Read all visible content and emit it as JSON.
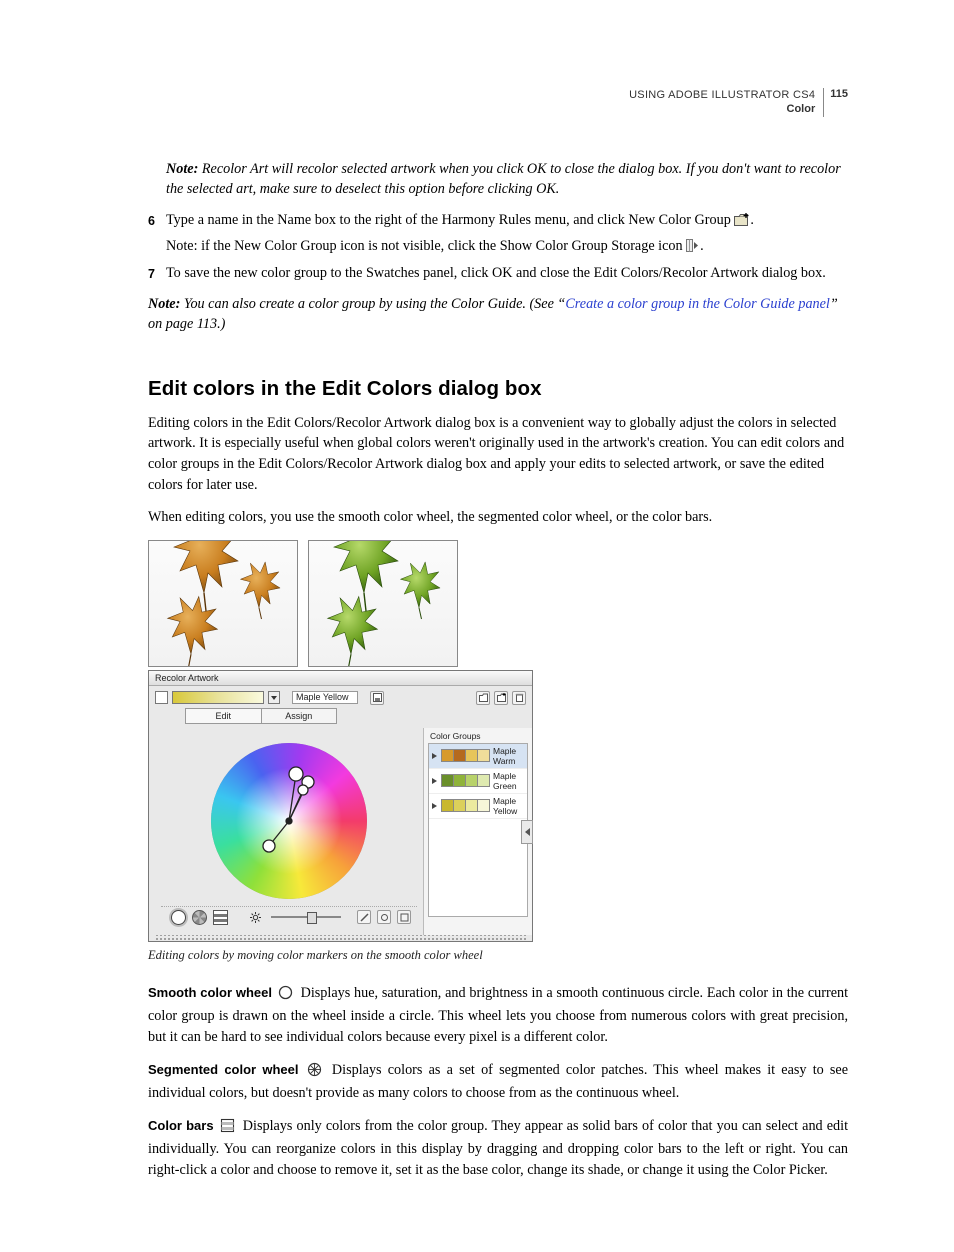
{
  "header": {
    "product": "USING ADOBE ILLUSTRATOR CS4",
    "section": "Color",
    "page": "115"
  },
  "notes": {
    "n1_label": "Note:",
    "n1_text": " Recolor Art will recolor selected artwork when you click OK to close the dialog box. If you don't want to recolor the selected art, make sure to deselect this option before clicking OK.",
    "n2_label": "Note:",
    "n2_text": " if the New Color Group icon is not visible, click the Show Color Group Storage icon ",
    "n3_label": "Note:",
    "n3_pre": " You can also create a color group by using the Color Guide. (See “",
    "n3_link": "Create a color group in the Color Guide panel",
    "n3_post": "” on page 113.)"
  },
  "steps": {
    "s6_num": "6",
    "s6_text": "Type a name in the Name box to the right of the Harmony Rules menu, and click New Color Group ",
    "s6_tail": ".",
    "s7_num": "7",
    "s7_text": "To save the new color group to the Swatches panel, click OK and close the Edit Colors/Recolor Artwork dialog box."
  },
  "section_heading": "Edit colors in the Edit Colors dialog box",
  "para1": "Editing colors in the Edit Colors/Recolor Artwork dialog box is a convenient way to globally adjust the colors in selected artwork. It is especially useful when global colors weren't originally used in the artwork's creation. You can edit colors and color groups in the Edit Colors/Recolor Artwork dialog box and apply your edits to selected artwork, or save the edited colors for later use.",
  "para2": "When editing colors, you use the smooth color wheel, the segmented color wheel, or the color bars.",
  "dialog": {
    "title": "Recolor Artwork",
    "name_field": "Maple Yellow",
    "tab_edit": "Edit",
    "tab_assign": "Assign",
    "cg_title": "Color Groups",
    "groups": [
      {
        "label": "Maple Warm",
        "c": [
          "#d79a2b",
          "#b56a1e",
          "#e7c55a",
          "#f0dd9a"
        ]
      },
      {
        "label": "Maple Green",
        "c": [
          "#6a8f2a",
          "#8fb33a",
          "#b8d26a",
          "#dfeab0"
        ]
      },
      {
        "label": "Maple Yellow",
        "c": [
          "#c9b82f",
          "#dcd05a",
          "#ecea9e",
          "#f7f6d8"
        ]
      }
    ]
  },
  "caption": "Editing colors by moving color markers on the smooth color wheel",
  "defs": {
    "d1_term": "Smooth color wheel",
    "d1_text": "   Displays hue, saturation, and brightness in a smooth continuous circle. Each color in the current color group is drawn on the wheel inside a circle. This wheel lets you choose from numerous colors with great precision, but it can be hard to see individual colors because every pixel is a different color.",
    "d2_term": "Segmented color wheel",
    "d2_text": "   Displays colors as a set of segmented color patches. This wheel makes it easy to see individual colors, but doesn't provide as many colors to choose from as the continuous wheel.",
    "d3_term": "Color bars",
    "d3_text": "   Displays only colors from the color group. They appear as solid bars of color that you can select and edit individually. You can reorganize colors in this display by dragging and dropping color bars to the left or right. You can right-click a color and choose to remove it, set it as the base color, change its shade, or change it using the Color Picker."
  }
}
